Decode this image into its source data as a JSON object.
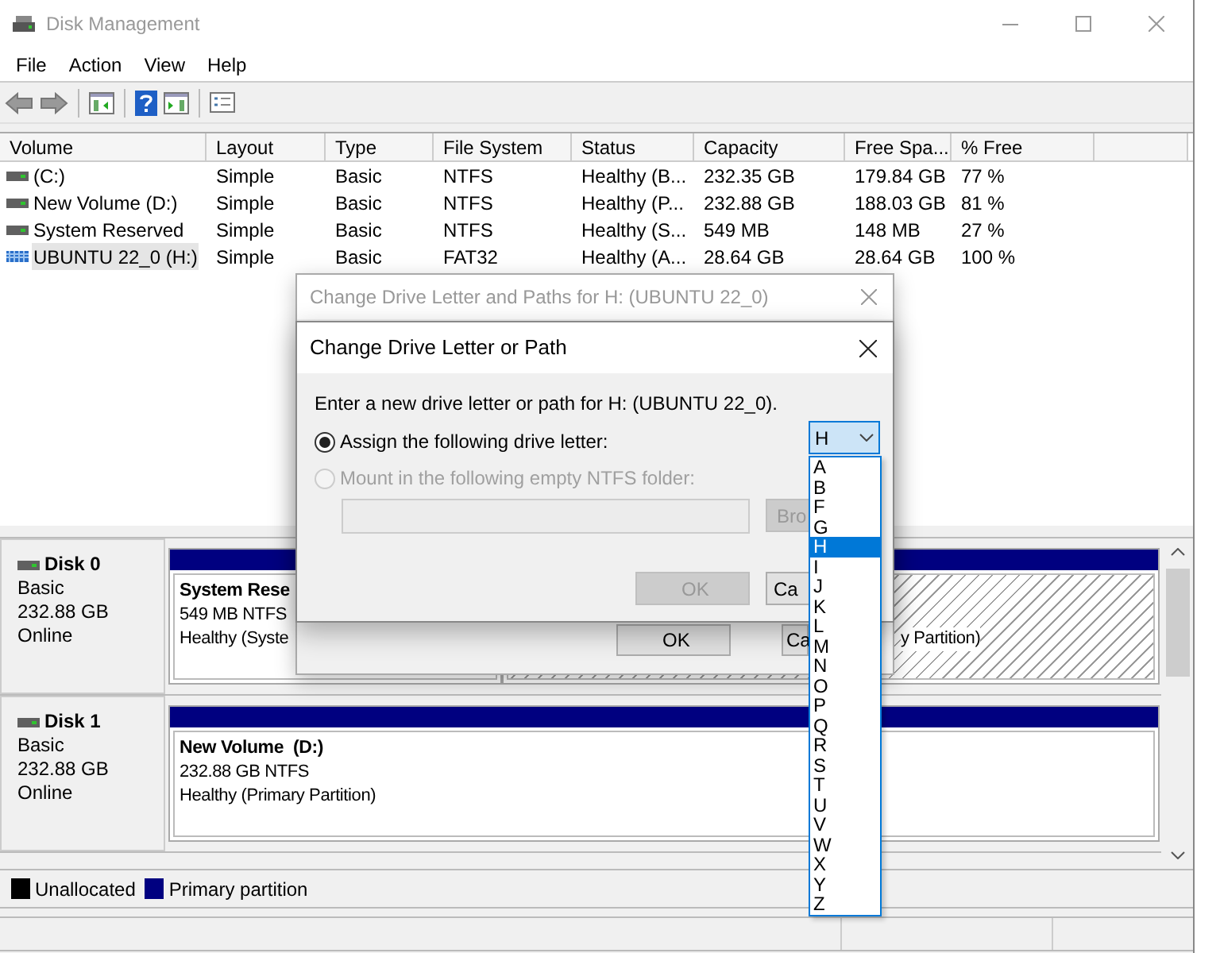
{
  "window": {
    "title": "Disk Management"
  },
  "menu": [
    {
      "label": "File"
    },
    {
      "label": "Action"
    },
    {
      "label": "View"
    },
    {
      "label": "Help"
    }
  ],
  "volume_table": {
    "columns": [
      "Volume",
      "Layout",
      "Type",
      "File System",
      "Status",
      "Capacity",
      "Free Spa...",
      "% Free"
    ],
    "rows": [
      {
        "kind": "disk",
        "selected": false,
        "cells": [
          "(C:)",
          "Simple",
          "Basic",
          "NTFS",
          "Healthy (B...",
          "232.35 GB",
          "179.84 GB",
          "77 %"
        ]
      },
      {
        "kind": "disk",
        "selected": false,
        "cells": [
          "New Volume (D:)",
          "Simple",
          "Basic",
          "NTFS",
          "Healthy (P...",
          "232.88 GB",
          "188.03 GB",
          "81 %"
        ]
      },
      {
        "kind": "disk",
        "selected": false,
        "cells": [
          "System Reserved",
          "Simple",
          "Basic",
          "NTFS",
          "Healthy (S...",
          "549 MB",
          "148 MB",
          "27 %"
        ]
      },
      {
        "kind": "removable",
        "selected": true,
        "cells": [
          "UBUNTU 22_0 (H:)",
          "Simple",
          "Basic",
          "FAT32",
          "Healthy (A...",
          "28.64 GB",
          "28.64 GB",
          "100 %"
        ]
      }
    ]
  },
  "disks": [
    {
      "name": "Disk 0",
      "type": "Basic",
      "size": "232.88 GB",
      "status": "Online",
      "partitions": [
        {
          "selected": false,
          "title": "System Rese",
          "lines": [
            "549 MB NTFS",
            "Healthy (Syste"
          ]
        },
        {
          "selected": true,
          "lines": [
            "y Partition)"
          ]
        }
      ]
    },
    {
      "name": "Disk 1",
      "type": "Basic",
      "size": "232.88 GB",
      "status": "Online",
      "partitions": [
        {
          "selected": false,
          "title": "New Volume  (D:)",
          "lines": [
            "232.88 GB NTFS",
            "Healthy (Primary Partition)"
          ]
        }
      ]
    }
  ],
  "legend": [
    {
      "label": "Unallocated",
      "color": "#000000"
    },
    {
      "label": "Primary partition",
      "color": "#000080"
    }
  ],
  "parent_dialog": {
    "title": "Change Drive Letter and Paths for H: (UBUNTU 22_0)",
    "buttons": [
      {
        "label": "OK"
      },
      {
        "label": "Ca"
      }
    ]
  },
  "dialog": {
    "title": "Change Drive Letter or Path",
    "prompt": "Enter a new drive letter or path for H: (UBUNTU 22_0).",
    "options": [
      {
        "label": "Assign the following drive letter:",
        "selected": true,
        "disabled": false
      },
      {
        "label": "Mount in the following empty NTFS folder:",
        "selected": false,
        "disabled": true
      }
    ],
    "folder_field": {
      "disabled": true
    },
    "browse_button": {
      "label": "Bro",
      "disabled": true
    },
    "buttons": [
      {
        "label": "OK",
        "disabled": true
      },
      {
        "label": "Ca",
        "disabled": false
      }
    ],
    "drive_letter": {
      "value": "H",
      "expanded": true,
      "options": [
        {
          "label": "A",
          "selected": false
        },
        {
          "label": "B",
          "selected": false
        },
        {
          "label": "F",
          "selected": false
        },
        {
          "label": "G",
          "selected": false
        },
        {
          "label": "H",
          "selected": true
        },
        {
          "label": "I",
          "selected": false
        },
        {
          "label": "J",
          "selected": false
        },
        {
          "label": "K",
          "selected": false
        },
        {
          "label": "L",
          "selected": false
        },
        {
          "label": "M",
          "selected": false
        },
        {
          "label": "N",
          "selected": false
        },
        {
          "label": "O",
          "selected": false
        },
        {
          "label": "P",
          "selected": false
        },
        {
          "label": "Q",
          "selected": false
        },
        {
          "label": "R",
          "selected": false
        },
        {
          "label": "S",
          "selected": false
        },
        {
          "label": "T",
          "selected": false
        },
        {
          "label": "U",
          "selected": false
        },
        {
          "label": "V",
          "selected": false
        },
        {
          "label": "W",
          "selected": false
        },
        {
          "label": "X",
          "selected": false
        },
        {
          "label": "Y",
          "selected": false
        },
        {
          "label": "Z",
          "selected": false
        }
      ]
    }
  }
}
